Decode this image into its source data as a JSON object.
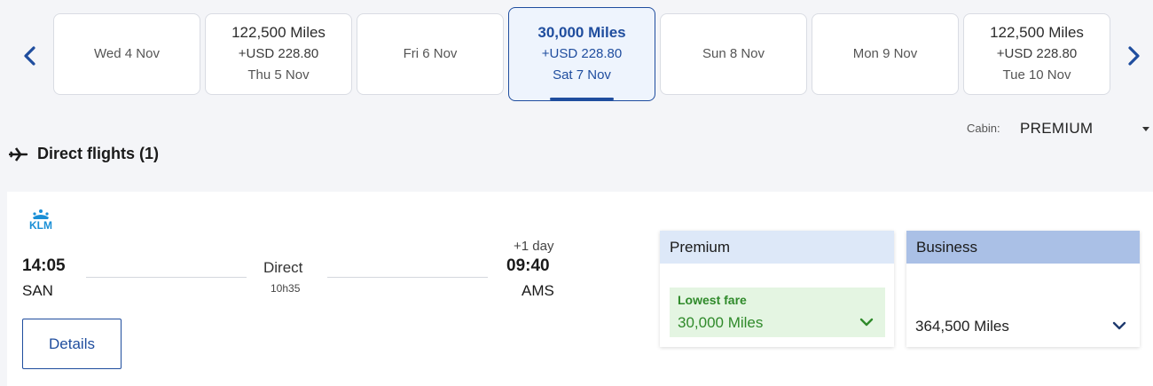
{
  "calendar": {
    "dates": [
      {
        "miles": "",
        "usd": "",
        "date": "Wed 4 Nov"
      },
      {
        "miles": "122,500 Miles",
        "usd": "+USD 228.80",
        "date": "Thu 5 Nov"
      },
      {
        "miles": "",
        "usd": "",
        "date": "Fri 6 Nov"
      },
      {
        "miles": "30,000 Miles",
        "usd": "+USD 228.80",
        "date": "Sat 7 Nov"
      },
      {
        "miles": "",
        "usd": "",
        "date": "Sun 8 Nov"
      },
      {
        "miles": "",
        "usd": "",
        "date": "Mon 9 Nov"
      },
      {
        "miles": "122,500 Miles",
        "usd": "+USD 228.80",
        "date": "Tue 10 Nov"
      }
    ],
    "selected_index": 3
  },
  "cabin": {
    "label": "Cabin:",
    "value": "PREMIUM"
  },
  "section": {
    "title": "Direct flights (1)"
  },
  "flight": {
    "airline": "KLM",
    "departure": {
      "time": "14:05",
      "airport": "SAN"
    },
    "arrival": {
      "time": "09:40",
      "airport": "AMS",
      "day_offset": "+1 day"
    },
    "stops": "Direct",
    "duration": "10h35",
    "details_label": "Details"
  },
  "fares": {
    "premium": {
      "title": "Premium",
      "tag": "Lowest fare",
      "value": "30,000 Miles"
    },
    "business": {
      "title": "Business",
      "value": "364,500 Miles"
    }
  },
  "colors": {
    "brand": "#1f4d9e",
    "klm": "#1a8fd6",
    "lowest_fare": "#2f8a2a"
  },
  "icons": {
    "prev": "chevron-left-icon",
    "next": "chevron-right-icon",
    "plane": "plane-icon",
    "expand": "chevron-down-icon"
  }
}
